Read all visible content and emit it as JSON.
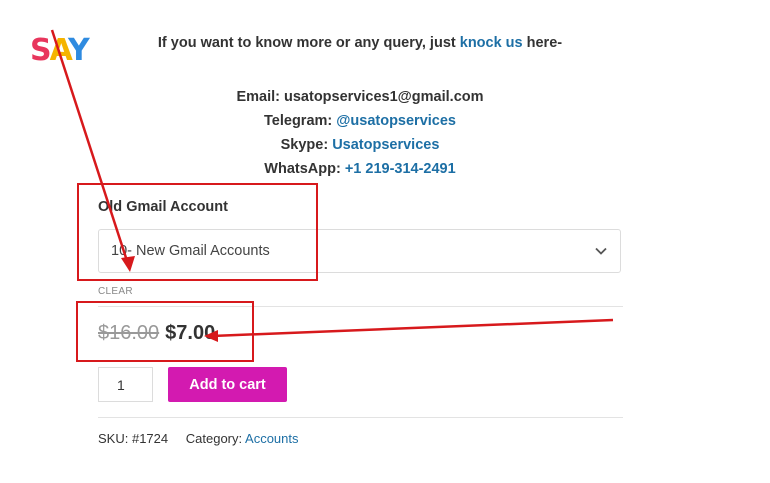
{
  "logo": {
    "letters": [
      "S",
      "A",
      "Y"
    ]
  },
  "intro": {
    "text": "If you want to know more or any query, just ",
    "link": "knock us",
    "suffix": " here-"
  },
  "contacts": {
    "email_label": "Email: ",
    "email_value": "usatopservices1@gmail.com",
    "telegram_label": "Telegram: ",
    "telegram_value": "@usatopservices",
    "skype_label": "Skype: ",
    "skype_value": "Usatopservices",
    "whatsapp_label": "WhatsApp: ",
    "whatsapp_value": "+1 219-314-2491"
  },
  "product": {
    "attribute_label": "Old Gmail Account",
    "selected_option": "10- New Gmail Accounts",
    "clear_label": "CLEAR",
    "old_price": "$16.00",
    "new_price": "$7.00",
    "quantity": "1",
    "add_to_cart": "Add to cart",
    "sku_label": "SKU:",
    "sku_value": "#1724",
    "category_label": "Category:",
    "category_value": "Accounts"
  },
  "colors": {
    "link": "#1d6fa5",
    "button": "#d31ab0",
    "annotation": "#d7191c"
  }
}
